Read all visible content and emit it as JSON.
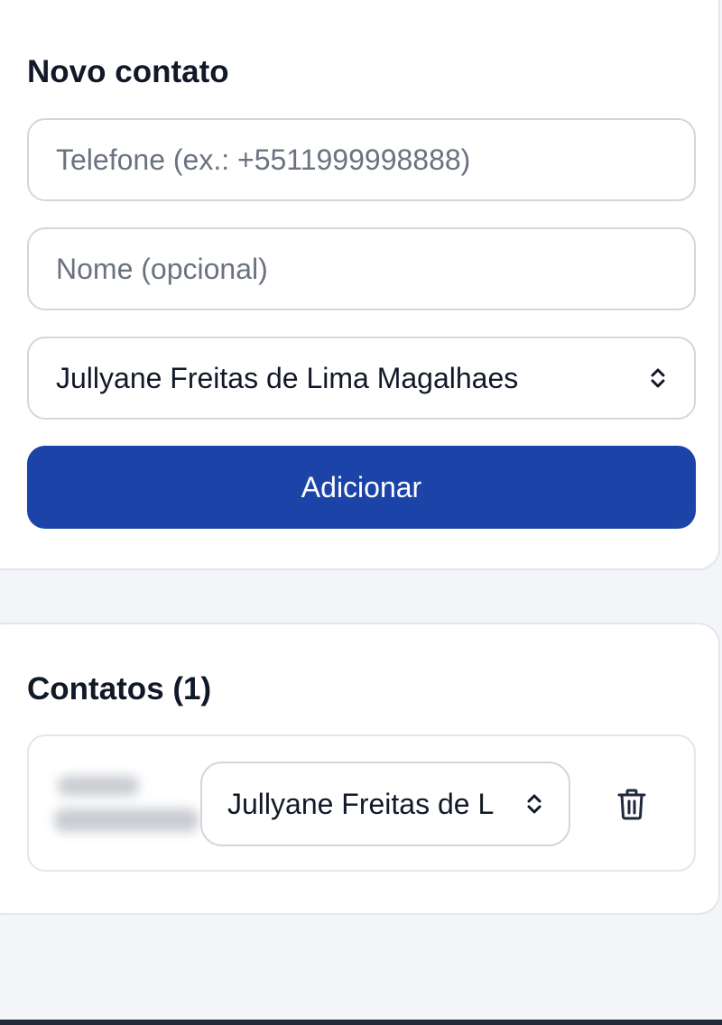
{
  "new_contact": {
    "title": "Novo contato",
    "phone_placeholder": "Telefone (ex.: +5511999998888)",
    "name_placeholder": "Nome (opcional)",
    "assignee_selected": "Jullyane Freitas de Lima Magalhaes",
    "add_button": "Adicionar"
  },
  "contacts": {
    "title": "Contatos (1)",
    "items": [
      {
        "assignee_selected": "Jullyane Freitas de L",
        "delete_icon": "trash-icon"
      }
    ]
  },
  "colors": {
    "primary": "#1b43a8",
    "background": "#f3f5f9",
    "card": "#ffffff",
    "border": "#d3d6dc",
    "text": "#111827",
    "placeholder": "#6b7280"
  },
  "icons": {
    "select": "chevron-up-down-icon",
    "delete": "trash-icon"
  }
}
